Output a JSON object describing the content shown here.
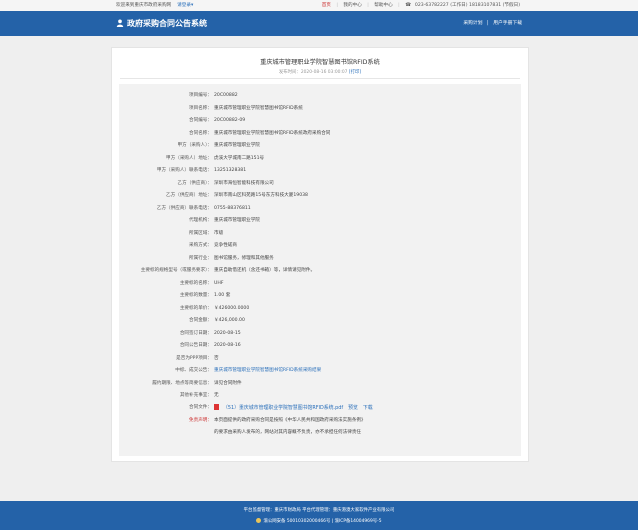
{
  "topbar": {
    "welcome": "欢迎来到重庆市政府采购网",
    "login": "请登录",
    "home": "首页",
    "my_center": "我的中心",
    "help_center": "帮助中心",
    "phone": "023-63782227 (工作日) 18183107831 (节假日)"
  },
  "header": {
    "brand": "政府采购合同公告系统",
    "nav": [
      "采购计划",
      "用户手册下载"
    ]
  },
  "notice": {
    "title": "重庆城市管理职业学院智慧图书馆RFID系统",
    "publish_label": "发布时间：",
    "publish_time": "2020-08-16 03:00:07",
    "print": "[打印]"
  },
  "fields": [
    {
      "label": "项目编号：",
      "value": "20C00882"
    },
    {
      "label": "项目名称：",
      "value": "重庆城市管理职业学院智慧图书馆RFID系统"
    },
    {
      "label": "合同编号：",
      "value": "20C00882-09"
    },
    {
      "label": "合同名称：",
      "value": "重庆城市管理职业学院智慧图书馆RFID系统政府采购合同"
    },
    {
      "label": "甲方（采购人）：",
      "value": "重庆城市管理职业学院"
    },
    {
      "label": "甲方（采购人）地址：",
      "value": "虎溪大学城南二路151号"
    },
    {
      "label": "甲方（采购人）联系电话：",
      "value": "13251328381"
    },
    {
      "label": "乙方（供应商）：",
      "value": "深圳市海恒智能科技有限公司"
    },
    {
      "label": "乙方（供应商）地址：",
      "value": "深圳市南山区科苑路15号东方科技大厦19038"
    },
    {
      "label": "乙方（供应商）联系电话：",
      "value": "0755-88376811"
    },
    {
      "label": "代理机构：",
      "value": "重庆城市管理职业学院"
    },
    {
      "label": "所属区域：",
      "value": "市级"
    },
    {
      "label": "采购方式：",
      "value": "竞争性磋商"
    },
    {
      "label": "所属行业：",
      "value": "图书馆服务，修理和其他服务"
    },
    {
      "label": "主要标的规格型号（或服务要求）：",
      "value": "重庆自助借还机（含还书箱）等，详情请见附件。"
    },
    {
      "label": "主要标的名称：",
      "value": "UHF"
    },
    {
      "label": "主要标的数量：",
      "value": "1.00 套"
    },
    {
      "label": "主要标的单价：",
      "value": "￥426000.0000"
    },
    {
      "label": "合同金额：",
      "value": "￥426,000.00"
    },
    {
      "label": "合同签订日期：",
      "value": "2020-08-15"
    },
    {
      "label": "合同公告日期：",
      "value": "2020-08-16"
    },
    {
      "label": "是否为PPP项目：",
      "value": "否"
    },
    {
      "label": "中标、成交公告：",
      "value": "重庆城市管理职业学院智慧图书馆RFID系统采购结果"
    },
    {
      "label": "履约期限、地点等简要信息：",
      "value": "详见合同附件"
    },
    {
      "label": "其他补充事宜：",
      "value": "无"
    }
  ],
  "attachment": {
    "label": "合同文件：",
    "file": "（51）重庆城市管理职业学院智慧图书馆RFID系统.pdf",
    "preview": "预览",
    "download": "下载"
  },
  "disclaimer": {
    "label": "免责声明：",
    "line1": "本页面提供的政府采购合同是按照《中华人民共和国政府采购法实施条例》",
    "line2": "的要求由采购人发布的，网站对其内容概不负责，亦不承担任何法律责任"
  },
  "footer": {
    "line1": "平台监督管理：重庆市财政局  平台代理管理：重庆港澳大家软件产业有限公司",
    "line2": "渝公网安备 50010302000466号  |  渝ICP备14004969号-5"
  }
}
